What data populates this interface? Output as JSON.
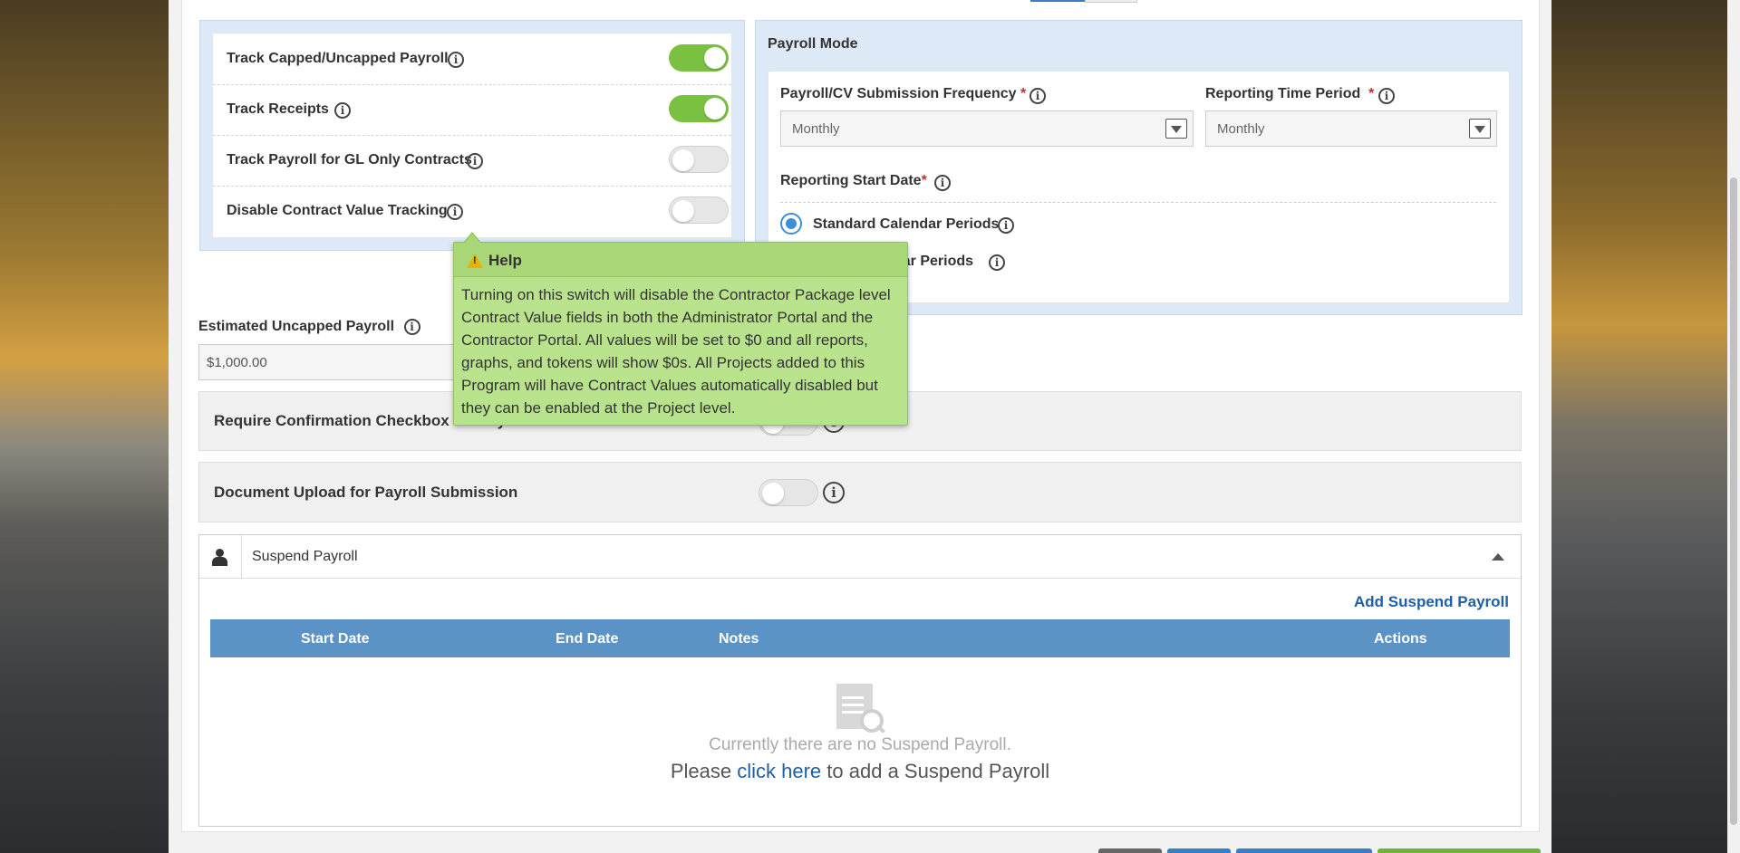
{
  "tracking": {
    "rows": [
      {
        "label": "Track Capped/Uncapped Payroll",
        "enabled": true
      },
      {
        "label": "Track Receipts",
        "enabled": true
      },
      {
        "label": "Track Payroll for GL Only Contracts",
        "enabled": false
      },
      {
        "label": "Disable Contract Value Tracking",
        "enabled": false
      }
    ]
  },
  "payroll_mode": {
    "title": "Payroll Mode",
    "frequency_label": "Payroll/CV Submission Frequency",
    "frequency_value": "Monthly",
    "period_label": "Reporting Time Period",
    "period_value": "Monthly",
    "start_date_label": "Reporting Start Date",
    "options": [
      {
        "label": "Standard Calendar Periods",
        "selected": true
      },
      {
        "label": "dar Periods",
        "selected": false
      }
    ]
  },
  "estimated": {
    "label": "Estimated Uncapped Payroll",
    "value": "$1,000.00"
  },
  "confirmation": {
    "label": "Require Confirmation Checkbox for Payroll Submission",
    "enabled": false
  },
  "document_upload": {
    "label": "Document Upload for Payroll Submission",
    "enabled": false
  },
  "suspend": {
    "title": "Suspend Payroll",
    "add_label": "Add Suspend Payroll",
    "columns": [
      "Start Date",
      "End Date",
      "Notes",
      "Actions"
    ],
    "empty_text": "Currently there are no Suspend Payroll.",
    "empty_prefix": "Please",
    "empty_link": "click here",
    "empty_suffix": "to add a Suspend Payroll"
  },
  "help": {
    "title": "Help",
    "text": "Turning on this switch will disable the Contractor Package level Contract Value fields in both the Administrator Portal and the Contractor Portal. All values will be set to $0 and all reports, graphs, and tokens will show $0s. All Projects added to this Program will have Contract Values automatically disabled but they can be enabled at the Project level."
  },
  "colors": {
    "toggle_on": "#7ac142",
    "table_header": "#5b93c7",
    "link": "#1f5fa6",
    "tooltip": "#b9e28d"
  }
}
